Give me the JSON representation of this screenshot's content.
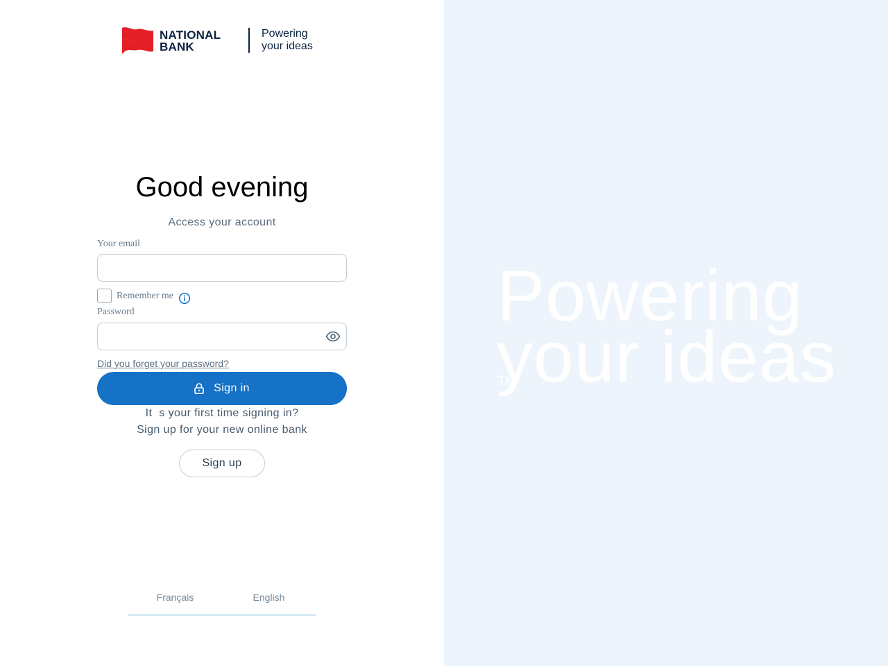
{
  "brand": {
    "name_line1": "NATIONAL",
    "name_line2": "BANK",
    "tagline_line1": "Powering",
    "tagline_line2": "your ideas",
    "logo_color": "#e41f26",
    "wordmark_color": "#0b2340"
  },
  "login": {
    "greeting": "Good evening",
    "subtitle": "Access your account",
    "email_label": "Your email",
    "email_value": "",
    "remember_label": "Remember me",
    "remember_checked": false,
    "password_label": "Password",
    "password_value": "",
    "forgot_link": "Did you forget your password?",
    "signin_label": "Sign in",
    "first_time_text": "Its your first time signing in?",
    "signup_prompt": "Sign up for your new online bank",
    "signup_label": "Sign up"
  },
  "languages": [
    "Français",
    "English"
  ],
  "hero": {
    "line1": "Powering",
    "line2": "your ideas",
    "trademark": "TM",
    "background": "#edf4fb"
  },
  "colors": {
    "primary_button": "#1572c6",
    "text_muted": "#5b6e7f",
    "input_border": "#c4ccd4"
  },
  "icons": {
    "info": "info-icon",
    "eye": "eye-icon",
    "lock": "lock-icon",
    "logo": "national-bank-flag-logo"
  }
}
